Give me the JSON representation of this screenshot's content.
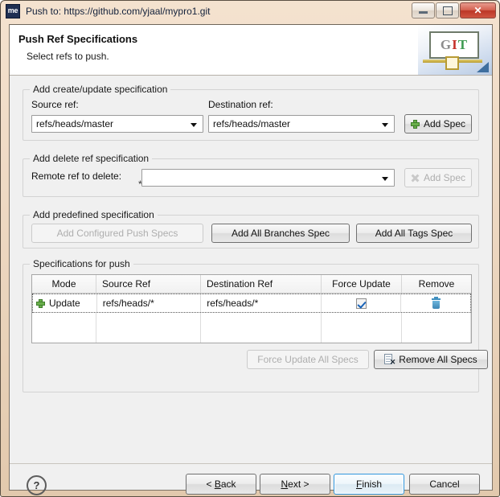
{
  "window": {
    "app_icon_label": "me",
    "title": "Push to: https://github.com/yjaal/mypro1.git",
    "controls": {
      "minimize": "minimize-button",
      "maximize": "maximize-button",
      "close": "✕"
    }
  },
  "header": {
    "title": "Push Ref Specifications",
    "subtitle": "Select refs to push.",
    "logo": {
      "g": "G",
      "i": "I",
      "t": "T"
    }
  },
  "create_update_group": {
    "legend": "Add create/update specification",
    "source_label": "Source ref:",
    "source_value": "refs/heads/master",
    "destination_label": "Destination ref:",
    "destination_value": "refs/heads/master",
    "add_spec_label": "Add Spec"
  },
  "delete_group": {
    "legend": "Add delete ref specification",
    "remote_label": "Remote ref to delete:",
    "remote_value": "",
    "required_marker": "*",
    "add_spec_label": "Add Spec"
  },
  "predefined_group": {
    "legend": "Add predefined specification",
    "configured_push_specs_label": "Add Configured Push Specs",
    "all_branches_label": "Add All Branches Spec",
    "all_tags_label": "Add All Tags Spec"
  },
  "specs_group": {
    "legend": "Specifications for push",
    "columns": [
      "Mode",
      "Source Ref",
      "Destination Ref",
      "Force Update",
      "Remove"
    ],
    "rows": [
      {
        "mode": "Update",
        "source_ref": "refs/heads/*",
        "destination_ref": "refs/heads/*",
        "force_update": true,
        "remove_icon": "trash-icon"
      }
    ],
    "force_update_all_label": "Force Update All Specs",
    "remove_all_label": "Remove All Specs"
  },
  "footer": {
    "help_label": "?",
    "back_pre": "< ",
    "back_mnemonic": "B",
    "back_post": "ack",
    "next_mnemonic": "N",
    "next_post": "ext >",
    "finish_mnemonic": "F",
    "finish_post": "inish",
    "cancel_label": "Cancel"
  },
  "colors": {
    "accent_focus": "#2f96dd",
    "title_close": "#bb3726",
    "green_plus": "#6ab04c",
    "trash_blue": "#3d86b5",
    "check_blue": "#1862b8",
    "dialog_bg": "#f0f0f0",
    "frame": "#e2c9ad"
  }
}
